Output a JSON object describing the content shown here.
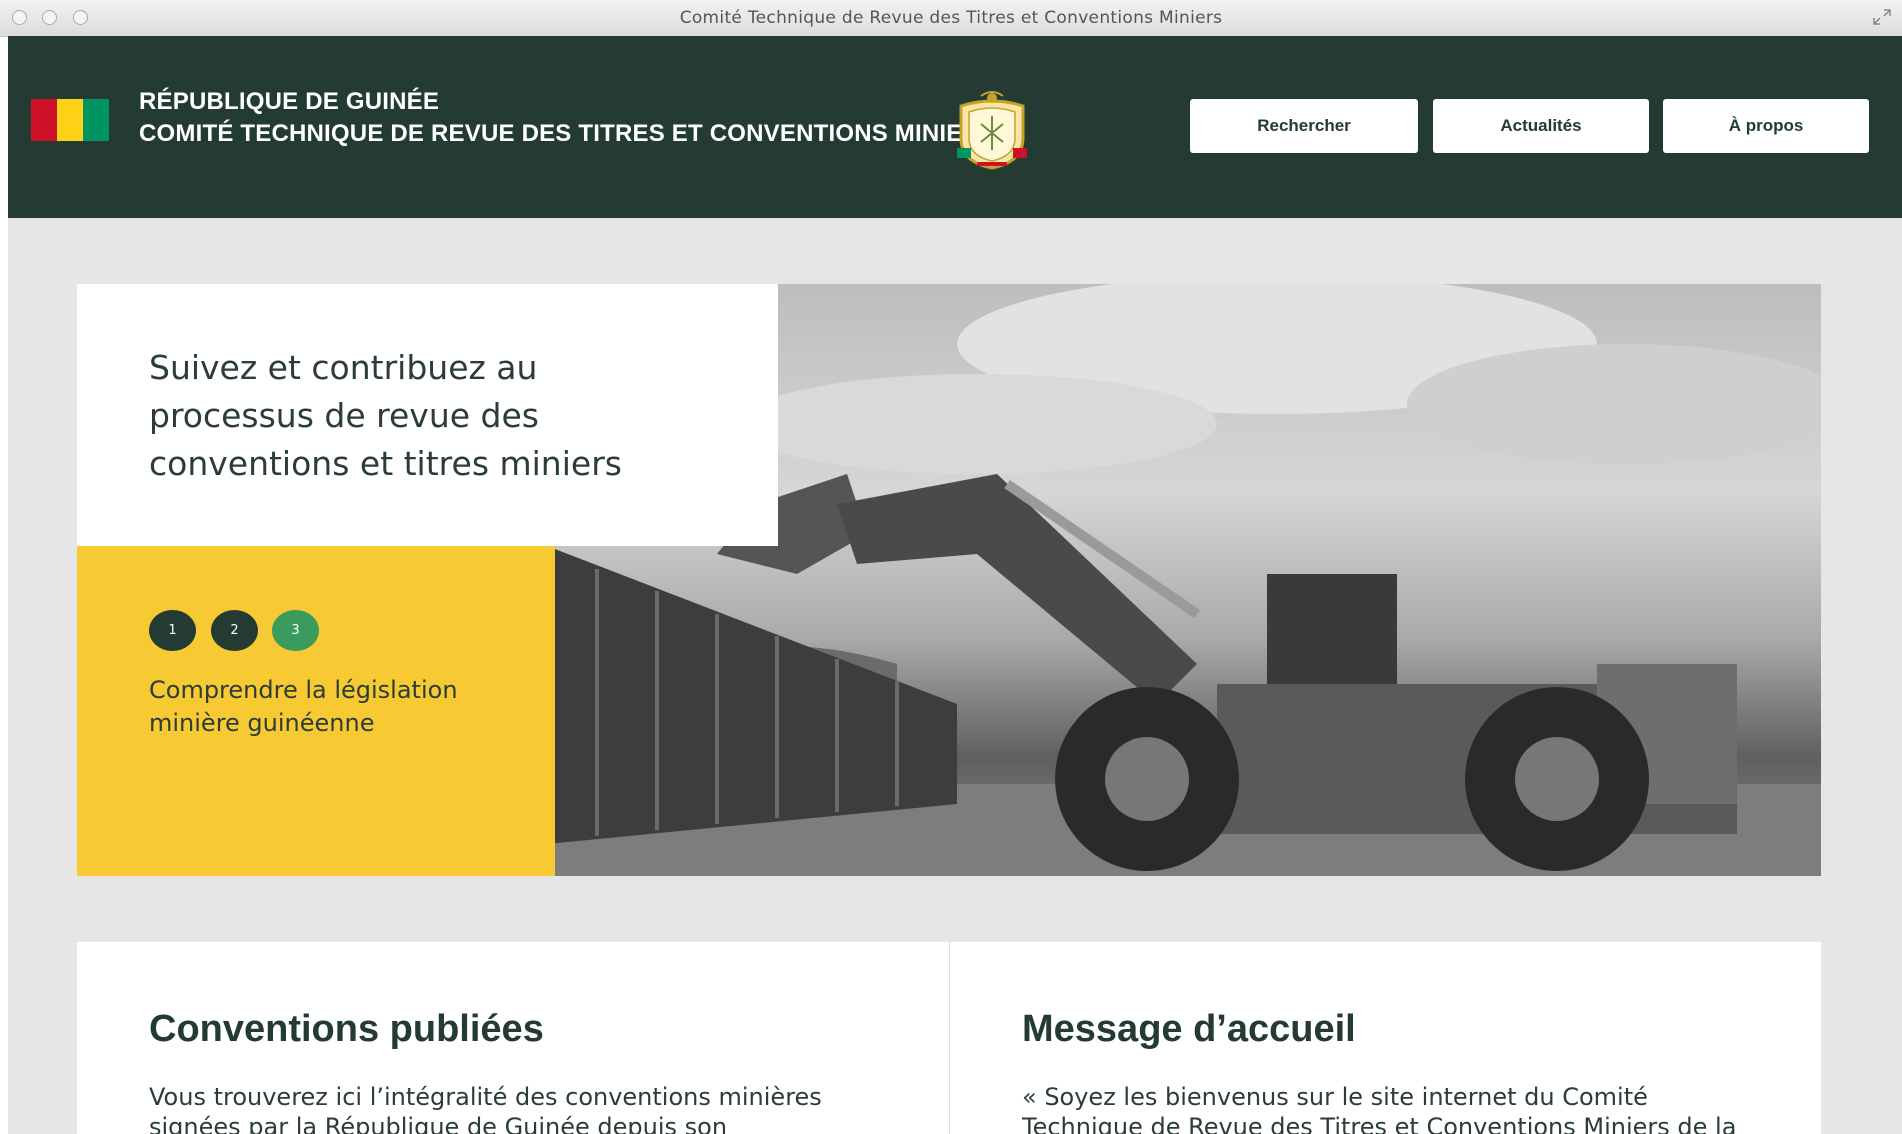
{
  "window": {
    "title": "Comité Technique de Revue des Titres et Conventions Miniers"
  },
  "header": {
    "country": "RÉPUBLIQUE DE GUINÉE",
    "committee": "COMITÉ TECHNIQUE DE REVUE DES TITRES ET CONVENTIONS MINIERS",
    "flag_colors": [
      "#ce1126",
      "#fcd116",
      "#009460"
    ],
    "emblem_icon": "coat-of-arms-icon",
    "nav": [
      {
        "label": "Rechercher"
      },
      {
        "label": "Actualités"
      },
      {
        "label": "À propos"
      }
    ]
  },
  "hero": {
    "title": "Suivez et contribuez au processus de revue des conventions et titres miniers",
    "slides": [
      "1",
      "2",
      "3"
    ],
    "active_slide": "3",
    "caption": "Comprendre la législation minière guinéenne",
    "image_icon": "mining-loader-photo"
  },
  "panels": [
    {
      "title": "Conventions publiées",
      "text": "Vous trouverez ici l’intégralité des conventions minières signées par la République de Guinée depuis son"
    },
    {
      "title": "Message d’accueil",
      "text": "« Soyez les bienvenus sur le site internet du Comité Technique de Revue des Titres et Conventions Miniers de la"
    }
  ],
  "colors": {
    "header_bg": "#233b33",
    "accent_yellow": "#f7c933",
    "accent_green": "#3a9b5c"
  }
}
